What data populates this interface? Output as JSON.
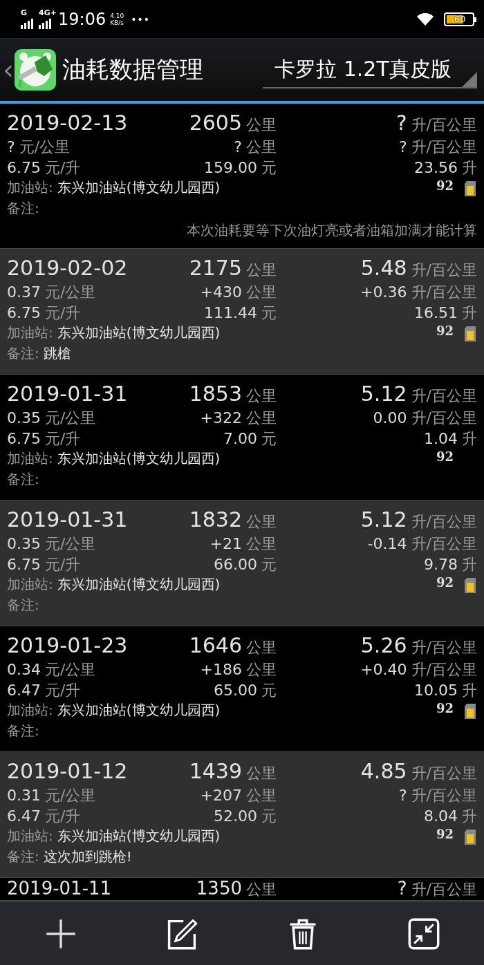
{
  "status_bar": {
    "signal_1": "G",
    "signal_2": "4G+",
    "time": "19:06",
    "speed_value": "4.10",
    "speed_unit": "KB/s",
    "more": "•••",
    "battery": "60"
  },
  "header": {
    "back": "‹",
    "title": "油耗数据管理",
    "car": "卡罗拉 1.2T真皮版"
  },
  "records": [
    {
      "date": "2019-02-13",
      "odometer": {
        "value": "2605",
        "unit": "公里"
      },
      "consumption": {
        "value": "?",
        "unit": "升/百公里"
      },
      "cost_per_km": {
        "value": "?",
        "unit": "元/公里"
      },
      "distance": {
        "value": "?",
        "unit": "公里"
      },
      "consumption_change": {
        "value": "?",
        "unit": "升/百公里"
      },
      "price": {
        "value": "6.75",
        "unit": "元/升"
      },
      "amount": {
        "value": "159.00",
        "unit": "元"
      },
      "volume": {
        "value": "23.56",
        "unit": "升"
      },
      "station_label": "加油站:",
      "station": "东兴加油站(博文幼儿园西)",
      "grade": "92",
      "full_tank": true,
      "note_label": "备注:",
      "hint": "本次油耗要等下次油灯亮或者油箱加满才能计算"
    },
    {
      "date": "2019-02-02",
      "odometer": {
        "value": "2175",
        "unit": "公里"
      },
      "consumption": {
        "value": "5.48",
        "unit": "升/百公里"
      },
      "cost_per_km": {
        "value": "0.37",
        "unit": "元/公里"
      },
      "distance": {
        "value": "+430",
        "unit": "公里"
      },
      "consumption_change": {
        "value": "+0.36",
        "unit": "升/百公里"
      },
      "price": {
        "value": "6.75",
        "unit": "元/升"
      },
      "amount": {
        "value": "111.44",
        "unit": "元"
      },
      "volume": {
        "value": "16.51",
        "unit": "升"
      },
      "station_label": "加油站:",
      "station": "东兴加油站(博文幼儿园西)",
      "grade": "92",
      "full_tank": true,
      "note_label": "备注:",
      "note": "跳槍"
    },
    {
      "date": "2019-01-31",
      "odometer": {
        "value": "1853",
        "unit": "公里"
      },
      "consumption": {
        "value": "5.12",
        "unit": "升/百公里"
      },
      "cost_per_km": {
        "value": "0.35",
        "unit": "元/公里"
      },
      "distance": {
        "value": "+322",
        "unit": "公里"
      },
      "consumption_change": {
        "value": "0.00",
        "unit": "升/百公里"
      },
      "price": {
        "value": "6.75",
        "unit": "元/升"
      },
      "amount": {
        "value": "7.00",
        "unit": "元"
      },
      "volume": {
        "value": "1.04",
        "unit": "升"
      },
      "station_label": "加油站:",
      "station": "东兴加油站(博文幼儿园西)",
      "grade": "92",
      "full_tank": false,
      "note_label": "备注:"
    },
    {
      "date": "2019-01-31",
      "odometer": {
        "value": "1832",
        "unit": "公里"
      },
      "consumption": {
        "value": "5.12",
        "unit": "升/百公里"
      },
      "cost_per_km": {
        "value": "0.35",
        "unit": "元/公里"
      },
      "distance": {
        "value": "+21",
        "unit": "公里"
      },
      "consumption_change": {
        "value": "-0.14",
        "unit": "升/百公里"
      },
      "price": {
        "value": "6.75",
        "unit": "元/升"
      },
      "amount": {
        "value": "66.00",
        "unit": "元"
      },
      "volume": {
        "value": "9.78",
        "unit": "升"
      },
      "station_label": "加油站:",
      "station": "东兴加油站(博文幼儿园西)",
      "grade": "92",
      "full_tank": true,
      "note_label": "备注:"
    },
    {
      "date": "2019-01-23",
      "odometer": {
        "value": "1646",
        "unit": "公里"
      },
      "consumption": {
        "value": "5.26",
        "unit": "升/百公里"
      },
      "cost_per_km": {
        "value": "0.34",
        "unit": "元/公里"
      },
      "distance": {
        "value": "+186",
        "unit": "公里"
      },
      "consumption_change": {
        "value": "+0.40",
        "unit": "升/百公里"
      },
      "price": {
        "value": "6.47",
        "unit": "元/升"
      },
      "amount": {
        "value": "65.00",
        "unit": "元"
      },
      "volume": {
        "value": "10.05",
        "unit": "升"
      },
      "station_label": "加油站:",
      "station": "东兴加油站(博文幼儿园西)",
      "grade": "92",
      "full_tank": true,
      "note_label": "备注:"
    },
    {
      "date": "2019-01-12",
      "odometer": {
        "value": "1439",
        "unit": "公里"
      },
      "consumption": {
        "value": "4.85",
        "unit": "升/百公里"
      },
      "cost_per_km": {
        "value": "0.31",
        "unit": "元/公里"
      },
      "distance": {
        "value": "+207",
        "unit": "公里"
      },
      "consumption_change": {
        "value": "?",
        "unit": "升/百公里"
      },
      "price": {
        "value": "6.47",
        "unit": "元/升"
      },
      "amount": {
        "value": "52.00",
        "unit": "元"
      },
      "volume": {
        "value": "8.04",
        "unit": "升"
      },
      "station_label": "加油站:",
      "station": "东兴加油站(博文幼儿园西)",
      "grade": "92",
      "full_tank": true,
      "note_label": "备注:",
      "note": "这次加到跳枪!"
    },
    {
      "date": "2019-01-11",
      "odometer": {
        "value": "1350",
        "unit": "公里"
      },
      "consumption": {
        "value": "?",
        "unit": "升/百公里"
      }
    }
  ],
  "toolbar": [
    {
      "kind": "add"
    },
    {
      "kind": "edit"
    },
    {
      "kind": "delete"
    },
    {
      "kind": "collapse"
    }
  ]
}
